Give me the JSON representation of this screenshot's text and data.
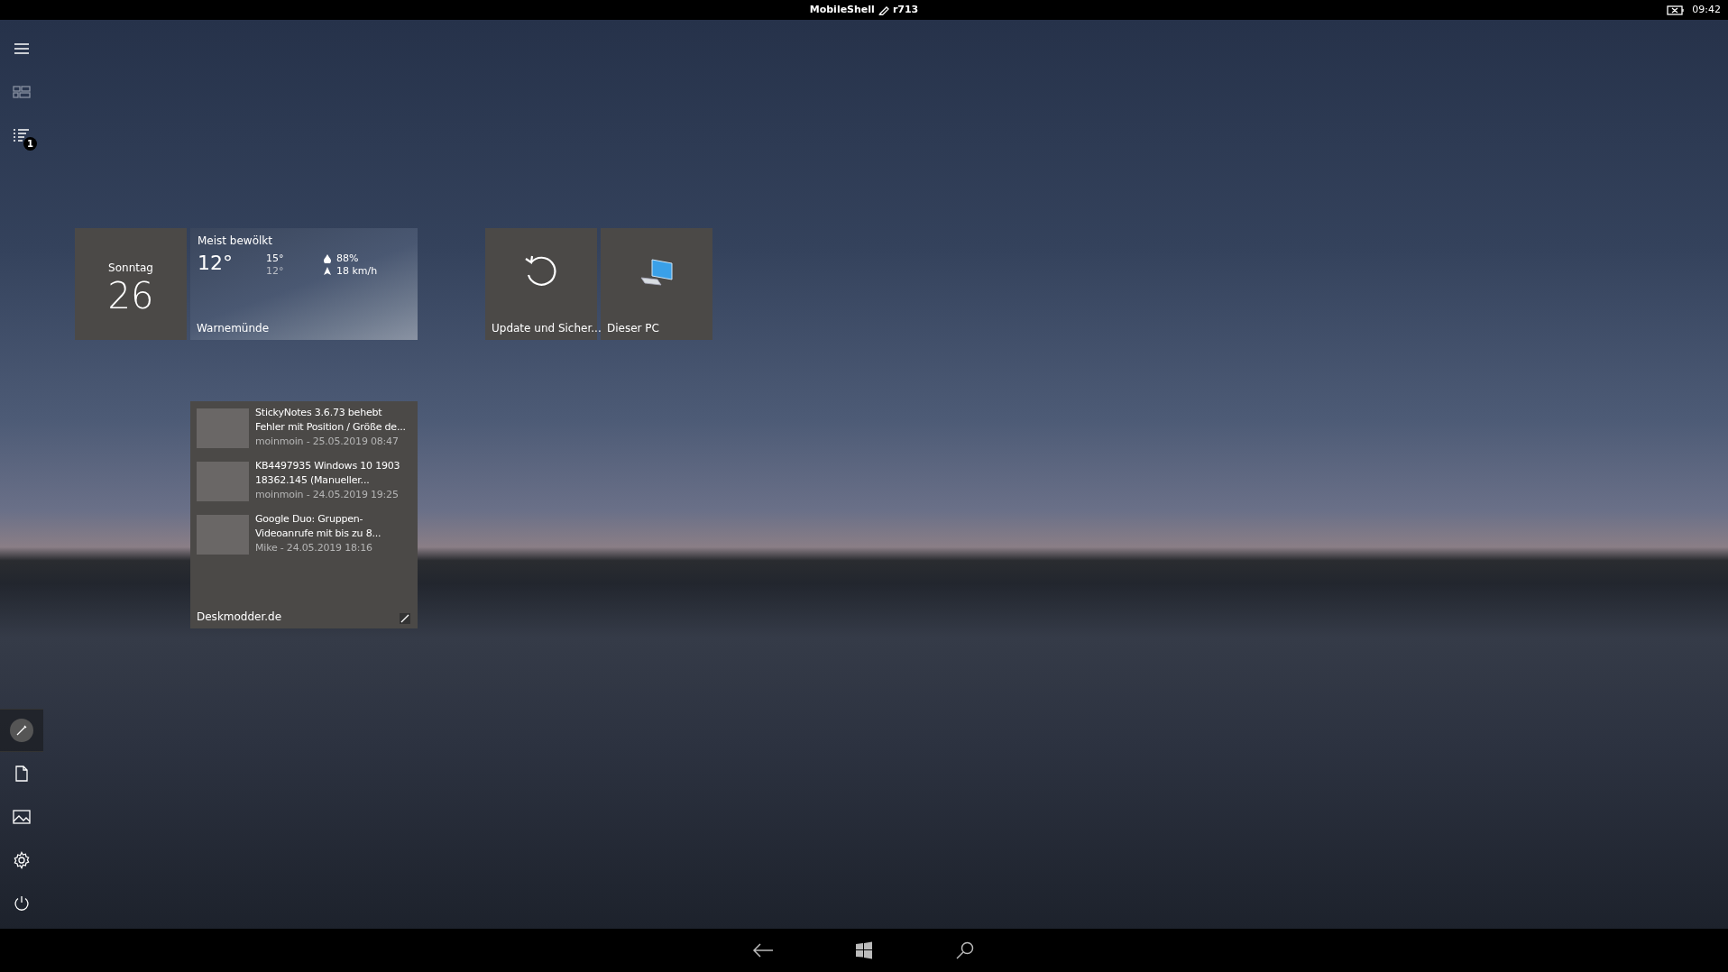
{
  "status_bar": {
    "app_name": "MobileShell",
    "build": "r713",
    "time": "09:42"
  },
  "sidebar": {
    "notification_count": "1"
  },
  "calendar_tile": {
    "weekday": "Sonntag",
    "day": "26"
  },
  "weather_tile": {
    "condition": "Meist bewölkt",
    "temperature": "12°",
    "high": "15°",
    "low": "12°",
    "humidity": "88%",
    "wind": "18 km/h",
    "location": "Warnemünde"
  },
  "app_tiles": [
    {
      "kind": "update",
      "label": "Update und Sicher..."
    },
    {
      "kind": "pc",
      "label": "Dieser PC"
    }
  ],
  "news_tile": {
    "items": [
      {
        "title": "StickyNotes 3.6.73 behebt Fehler mit Position / Größe de...",
        "meta": "moinmoin - 25.05.2019 08:47"
      },
      {
        "title": "KB4497935 Windows 10 1903 18362.145 (Manueller...",
        "meta": "moinmoin - 24.05.2019 19:25"
      },
      {
        "title": "Google Duo: Gruppen-Videoanrufe mit bis zu 8...",
        "meta": "Mike - 24.05.2019 18:16"
      }
    ],
    "source": "Deskmodder.de"
  }
}
